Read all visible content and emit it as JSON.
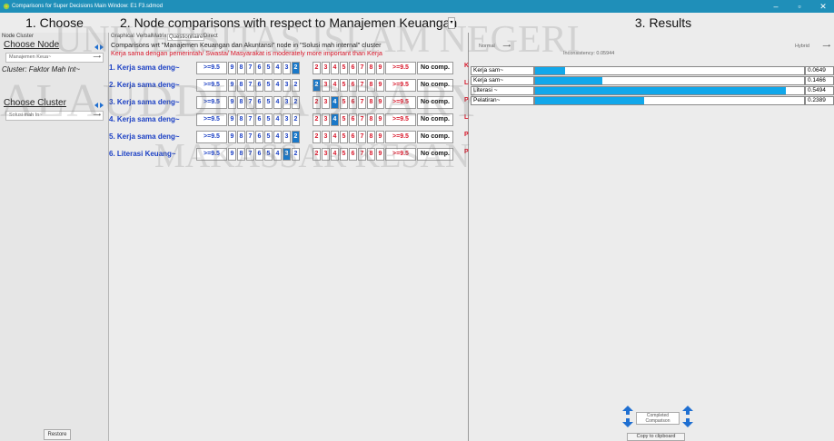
{
  "window": {
    "title": "Comparisons for Super Decisions Main Window: E1 F3.sdmod"
  },
  "panels": {
    "left_title": "1. Choose",
    "mid_title": "2. Node comparisons with respect to Manajemen Keuangan d~",
    "right_title": "3. Results"
  },
  "left": {
    "tabs": [
      "Node",
      "Cluster"
    ],
    "choose_node": "Choose Node",
    "node_combo": "Manajemen Keua~",
    "cluster_label": "Cluster: Faktor Mah Int~",
    "choose_cluster": "Choose Cluster",
    "cluster_combo": "Solusi mah In~",
    "restore": "Restore"
  },
  "mid": {
    "modes": [
      "Graphical",
      "Verbal",
      "Matrix",
      "Questionnaire",
      "Direct"
    ],
    "description": "Comparisons wrt \"Manajemen Keuangan dan Akuntansi\" node in \"Solusi mah internal\" cluster",
    "statement": "Kerja sama dengan pemerintah/ Swasta/ Masyarakat is moderately more important than Kerja",
    "scale_left": [
      ">=9.5",
      "9",
      "8",
      "7",
      "6",
      "5",
      "4",
      "3",
      "2"
    ],
    "scale_right": [
      "2",
      "3",
      "4",
      "5",
      "6",
      "7",
      "8",
      "9",
      ">=9.5"
    ],
    "no_comp": "No comp.",
    "rows": [
      {
        "label": "1. Kerja sama deng~",
        "tail": "K",
        "selected": "L8"
      },
      {
        "label": "2. Kerja sama deng~",
        "tail": "Li",
        "selected": "R0"
      },
      {
        "label": "3. Kerja sama deng~",
        "tail": "P",
        "selected": "R2"
      },
      {
        "label": "4. Kerja sama deng~",
        "tail": "Li",
        "selected": "R2"
      },
      {
        "label": "5. Kerja sama deng~",
        "tail": "P",
        "selected": "L8"
      },
      {
        "label": "6.  Literasi Keuang~",
        "tail": "P",
        "selected": "L7"
      }
    ]
  },
  "right": {
    "normal_combo": "Normal",
    "hybrid_combo": "Hybrid",
    "inconsistency": "Inconsistency: 0.05944",
    "results": [
      {
        "label": "Kerja sam~",
        "value": "0.0649",
        "fraction": 0.0649
      },
      {
        "label": "Kerja sam~",
        "value": "0.1466",
        "fraction": 0.1466
      },
      {
        "label": "Literasi ~",
        "value": "0.5494",
        "fraction": 0.5494
      },
      {
        "label": "Pelatiran~",
        "value": "0.2389",
        "fraction": 0.2389
      }
    ],
    "completed": "Completed",
    "comparison": "Comparison",
    "copy_clipboard": "Copy to clipboard"
  },
  "watermark": {
    "line1": "UNIVERSITAS ISLAM NEGERI",
    "line2": "ALAUDDIN ADDARY",
    "line3": "MAKASSAR KESAN"
  },
  "colors": {
    "titlebar": "#1f8fb9",
    "blue_text": "#1a3fc4",
    "red_text": "#d8172a",
    "bar": "#11a7ea",
    "selected_cell": "#1a78c8"
  }
}
